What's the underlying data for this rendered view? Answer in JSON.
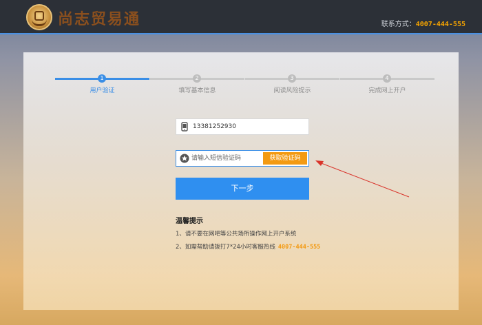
{
  "header": {
    "brand_name": "尚志贸易通",
    "contact_label": "联系方式：",
    "contact_phone": "4007-444-555"
  },
  "steps": [
    {
      "number": "1",
      "label": "用户验证",
      "active": true
    },
    {
      "number": "2",
      "label": "填写基本信息",
      "active": false
    },
    {
      "number": "3",
      "label": "阅读风险提示",
      "active": false
    },
    {
      "number": "4",
      "label": "完成网上开户",
      "active": false
    }
  ],
  "form": {
    "phone_value": "13381252930",
    "code_placeholder": "请输入短信验证码",
    "get_code_label": "获取验证码",
    "next_label": "下一步"
  },
  "tips": {
    "title": "温馨提示",
    "line1": "1、请不要在网吧等公共场所操作网上开户系统",
    "line2_text": "2、如需帮助请拨打7*24小时客服热线",
    "line2_phone": "4007-444-555"
  },
  "colors": {
    "accent": "#2f8ff0",
    "orange": "#f39a12",
    "annotation_arrow": "#d9342b"
  },
  "icons": {
    "phone": "mobile-phone-icon",
    "code": "star-badge-icon"
  }
}
